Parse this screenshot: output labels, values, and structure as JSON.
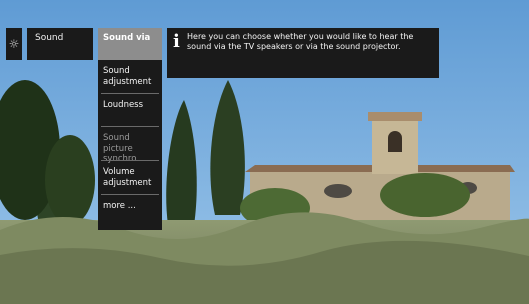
{
  "header": {
    "settings_icon": "gear-icon",
    "breadcrumb": "Sound"
  },
  "menu": {
    "items": [
      {
        "label": "Sound via",
        "state": "selected"
      },
      {
        "label": "Sound adjustment",
        "state": "normal"
      },
      {
        "label": "Loudness",
        "state": "normal"
      },
      {
        "label": "Sound picture synchro",
        "state": "disabled"
      },
      {
        "label": "Volume adjustment",
        "state": "normal"
      },
      {
        "label": "more ...",
        "state": "normal"
      }
    ]
  },
  "info": {
    "icon": "info-icon",
    "text": "Here you can choose whether you would like to hear the sound via the TV speakers or via the sound projector."
  },
  "colors": {
    "panel_bg": "#1a1a1a",
    "selected_bg": "#8d8d8d",
    "disabled_text": "#9a9a9a"
  }
}
